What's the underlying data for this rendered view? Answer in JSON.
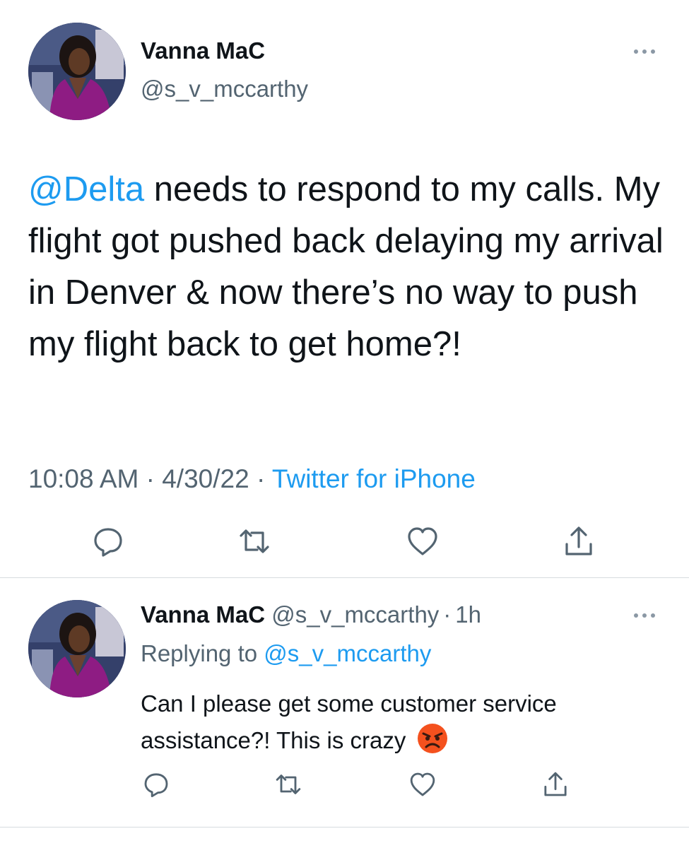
{
  "main_tweet": {
    "display_name": "Vanna MaC",
    "handle": "@s_v_mccarthy",
    "text_mention": "@Delta",
    "text_body": " needs to respond to my calls. My flight got pushed back delaying my arrival in Denver & now there’s no way to push my flight back to get home?!",
    "time": "10:08 AM",
    "sep1": "·",
    "date": "4/30/22",
    "sep2": "·",
    "source": "Twitter for iPhone",
    "more_icon": "more-dots-icon",
    "actions": [
      "reply-icon",
      "retweet-icon",
      "like-icon",
      "share-icon"
    ]
  },
  "reply_tweet": {
    "display_name": "Vanna MaC",
    "handle": "@s_v_mccarthy",
    "sep": "·",
    "age": "1h",
    "replying_label": "Replying to",
    "replying_handle": "@s_v_mccarthy",
    "text": "Can I please get some customer service assistance?! This is crazy",
    "emoji": "angry-face-emoji",
    "more_icon": "more-dots-icon",
    "actions": [
      "reply-icon",
      "retweet-icon",
      "like-icon",
      "share-icon"
    ]
  },
  "colors": {
    "link": "#1d9bf0",
    "muted": "#536471",
    "icon": "#536471",
    "divider": "#d6dbdf",
    "emoji": "#f4511e"
  }
}
